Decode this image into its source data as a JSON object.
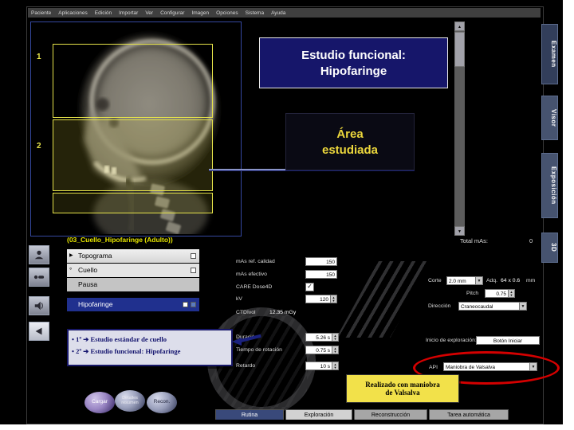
{
  "menu": {
    "items": [
      "Paciente",
      "Aplicaciones",
      "Edición",
      "Importar",
      "Ver",
      "Configurar",
      "Imagen",
      "Opciones",
      "Sistema",
      "Ayuda"
    ]
  },
  "right_tabs": {
    "examen": "Examen",
    "visor": "Visor",
    "exposicion": "Exposición",
    "tresd": "3D"
  },
  "scout": {
    "region1": "1",
    "region2": "2"
  },
  "callouts": {
    "functional_line1": "Estudio funcional:",
    "functional_line2": "Hipofaringe",
    "area_line1": "Área",
    "area_line2": "estudiada",
    "yellow_line1": "Realizado con maniobra",
    "yellow_line2": "de Valsalva",
    "blue_line1": "• 1º ➔ Estudio estándar de cuello",
    "blue_line2": "• 2º ➔ Estudio funcional: Hipofaringe"
  },
  "protocol": {
    "name": "(03_Cuello_Hipofaringe (Adulto))",
    "total_mas_label": "Total mAs:",
    "total_mas_value": "0"
  },
  "steps": {
    "s1": "Topograma",
    "s2": "Cuello",
    "s3": "Pausa",
    "s4": "Hipofaringe"
  },
  "scan": {
    "mas_ref_label": "mAs ref. calidad",
    "mas_ref_value": "150",
    "mas_eff_label": "mAs efectivo",
    "mas_eff_value": "150",
    "care_label": "CARE Dose4D",
    "kv_label": "kV",
    "kv_value": "120",
    "ctdi_label": "CTDIvol",
    "ctdi_value": "12.35 mGy",
    "duration_label": "Duración",
    "duration_value": "5.26 s",
    "rotation_label": "Tiempo de rotación",
    "rotation_value": "0.75 s",
    "delay_label": "Retardo",
    "delay_value": "10 s"
  },
  "recon": {
    "slice_label": "Corte",
    "slice_value": "2.0 mm",
    "acq_label": "Adq.",
    "acq_value": "64 x 0.6",
    "acq_unit": "mm",
    "pitch_label": "Pitch",
    "pitch_value": "0.75",
    "dir_label": "Dirección",
    "dir_value": "Craneocaudal",
    "start_label": "Inicio de exploración:",
    "start_value": "Botón Iniciar",
    "api_label": "API",
    "api_value": "Maniobra de Valsalva"
  },
  "buttons": {
    "cargar": "Cargar",
    "detalles": "Detalles resumen",
    "recon": "Recon."
  },
  "bottom_tabs": {
    "rutina": "Rutina",
    "exploracion": "Exploración",
    "reconstruccion": "Reconstrucción",
    "tarea": "Tarea automática"
  },
  "icons": {
    "up": "▲",
    "down": "▼",
    "drop": "▼",
    "check": "✓",
    "marker": "▶",
    "bullet_ring": "°"
  },
  "colors": {
    "accent_red": "#d40000",
    "annotation_yellow": "#f2e14a",
    "annotation_navy": "#16166a",
    "highlight_yellow": "#e6e34a"
  }
}
